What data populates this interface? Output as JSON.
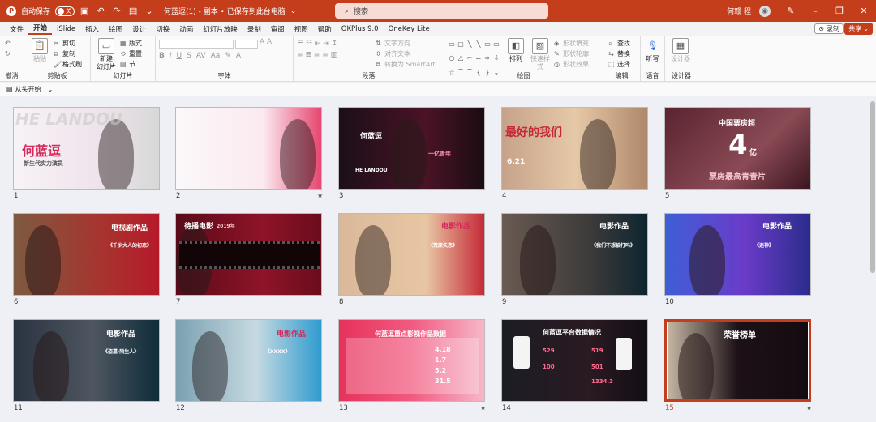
{
  "titlebar": {
    "autosave": "自动保存",
    "toggle": "关",
    "doc_title": "何蓝逗(1) - 副本 • 已保存到此台电脑",
    "search_placeholder": "搜索",
    "user": "何赣 程"
  },
  "tabs": [
    "文件",
    "开始",
    "iSlide",
    "插入",
    "绘图",
    "设计",
    "切换",
    "动画",
    "幻灯片放映",
    "录制",
    "审阅",
    "视图",
    "帮助",
    "OKPlus 9.0",
    "OneKey Lite"
  ],
  "active_tab": "开始",
  "record_label": "录制",
  "share_label": "共享",
  "ribbon": {
    "undo_group": "撤消",
    "clipboard": {
      "label": "剪贴板",
      "paste": "粘贴",
      "cut": "剪切",
      "copy": "复制",
      "format": "格式刷"
    },
    "slides": {
      "label": "幻灯片",
      "new": "新建",
      "new2": "幻灯片",
      "layout": "版式",
      "reset": "重置",
      "section": "节"
    },
    "font": {
      "label": "字体"
    },
    "paragraph": {
      "label": "段落",
      "dir": "文字方向",
      "align": "对齐文本",
      "smartart": "转换为 SmartArt"
    },
    "drawing": {
      "label": "绘图",
      "arrange": "排列",
      "quick": "快速样式",
      "fill": "形状填充",
      "outline": "形状轮廓",
      "effect": "形状效果"
    },
    "editing": {
      "label": "编辑",
      "find": "查找",
      "replace": "替换",
      "select": "选择"
    },
    "voice": {
      "label": "语音",
      "dictate": "听写"
    },
    "designer": {
      "label": "设计器",
      "btn": "设计器"
    }
  },
  "qat_label": "从头开始",
  "slides": [
    {
      "num": "1",
      "title": "何蓝逗",
      "sub": "新生代实力演员",
      "bg": "HE LANDOU"
    },
    {
      "num": "2",
      "title": "",
      "star": "★"
    },
    {
      "num": "3",
      "title": "何蓝逗",
      "sub": "HE LANDOU",
      "tag": "一亿青年"
    },
    {
      "num": "4",
      "title": "最好的我们",
      "date": "6.21"
    },
    {
      "num": "5",
      "title": "中国票房超",
      "big": "4",
      "unit": "亿",
      "sub": "票房最高青春片"
    },
    {
      "num": "6",
      "title": "电视剧作品",
      "name": "《千岁大人的初恋》"
    },
    {
      "num": "7",
      "title": "待播电影",
      "year": "2019年"
    },
    {
      "num": "8",
      "title": "电影作品",
      "name": "《荒原失恋》"
    },
    {
      "num": "9",
      "title": "电影作品",
      "name": "《我们不想被打吗》"
    },
    {
      "num": "10",
      "title": "电影作品",
      "name": "《迷神》"
    },
    {
      "num": "11",
      "title": "电影作品",
      "name": "《盗墓·陌生人》"
    },
    {
      "num": "12",
      "title": "电影作品",
      "name": "《XXXX》"
    },
    {
      "num": "13",
      "title": "何蓝逗重点影视作品数据",
      "v1": "4.18",
      "v2": "1.7",
      "v3": "5.2",
      "v4": "31.5",
      "star": "★"
    },
    {
      "num": "14",
      "title": "何蓝逗平台数据情况",
      "v1": "529",
      "v2": "100",
      "v3": "519",
      "v4": "501",
      "v5": "1334.3"
    },
    {
      "num": "15",
      "title": "荣誉榜单",
      "star": "★"
    }
  ]
}
